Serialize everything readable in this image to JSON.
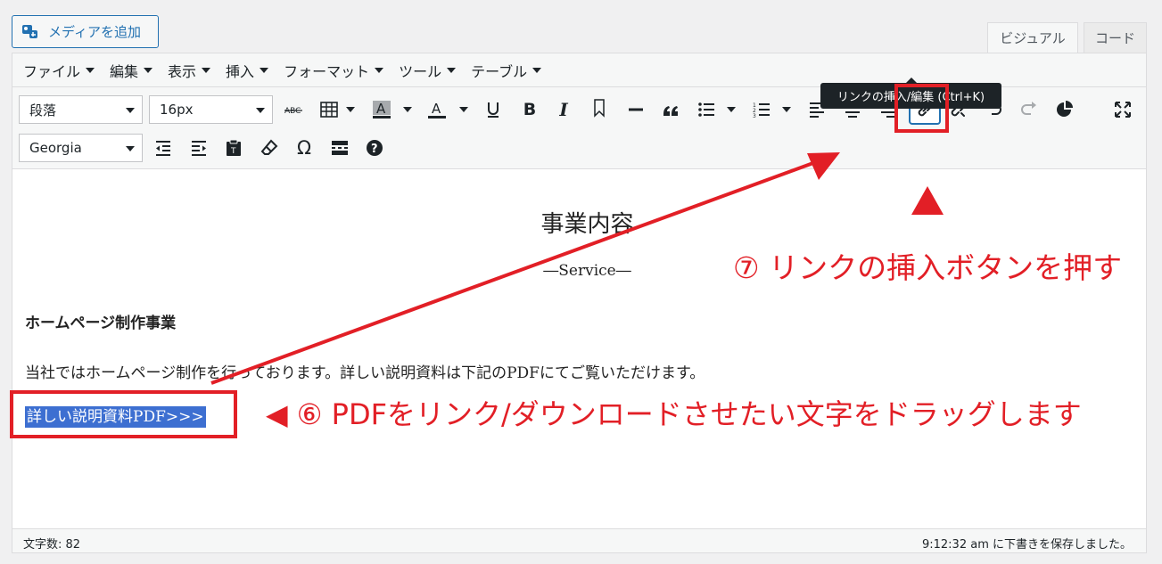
{
  "toolbar_top": {
    "media_button_label": "メディアを追加",
    "tab_visual": "ビジュアル",
    "tab_code": "コード"
  },
  "menubar": {
    "file": "ファイル",
    "edit": "編集",
    "view": "表示",
    "insert": "挿入",
    "format": "フォーマット",
    "tools": "ツール",
    "table": "テーブル"
  },
  "toolbar": {
    "paragraph_select": "段落",
    "fontsize_select": "16px",
    "fontfamily_select": "Georgia",
    "link_tooltip": "リンクの挿入/編集 (Ctrl+K)"
  },
  "content": {
    "title": "事業内容",
    "subtitle": "―Service―",
    "section_heading": "ホームページ制作事業",
    "paragraph": "当社ではホームページ制作を行っております。詳しい説明資料は下記のPDFにてご覧いただけます。",
    "selected_link_text": "詳しい説明資料PDF>>>"
  },
  "status": {
    "word_count": "文字数: 82",
    "saved_message": "9:12:32 am に下書きを保存しました。"
  },
  "annotations": {
    "step7": "⑦ リンクの挿入ボタンを押す",
    "step6": "◀ ⑥ PDFをリンク/ダウンロードさせたい文字をドラッグします"
  },
  "colors": {
    "annotation_red": "#e21f26",
    "selection_blue": "#3d6fd1",
    "wp_blue": "#2271b1"
  }
}
